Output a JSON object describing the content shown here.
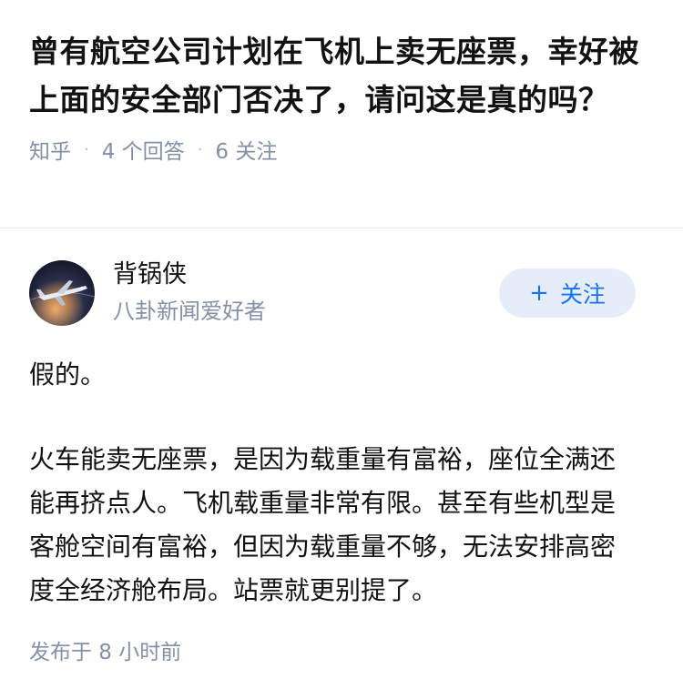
{
  "question": {
    "title": "曾有航空公司计划在飞机上卖无座票，幸好被上面的安全部门否决了，请问这是真的吗？",
    "source": "知乎",
    "answers_count": "4 个回答",
    "followers_count": "6 关注"
  },
  "author": {
    "avatar_icon": "airplane-avatar-icon",
    "name": "背锅侠",
    "bio": "八卦新闻爱好者",
    "follow_label": "关注",
    "follow_icon": "plus-icon"
  },
  "answer": {
    "paragraphs": [
      "假的。",
      "火车能卖无座票，是因为载重量有富裕，座位全满还能再挤点人。飞机载重量非常有限。甚至有些机型是客舱空间有富裕，但因为载重量不够，无法安排高密度全经济舱布局。站票就更别提了。"
    ],
    "published": "发布于 8 小时前"
  },
  "colors": {
    "accent": "#1772f6",
    "follow_bg": "#e5eef8",
    "meta_text": "#8590a6",
    "body_text": "#121212"
  }
}
